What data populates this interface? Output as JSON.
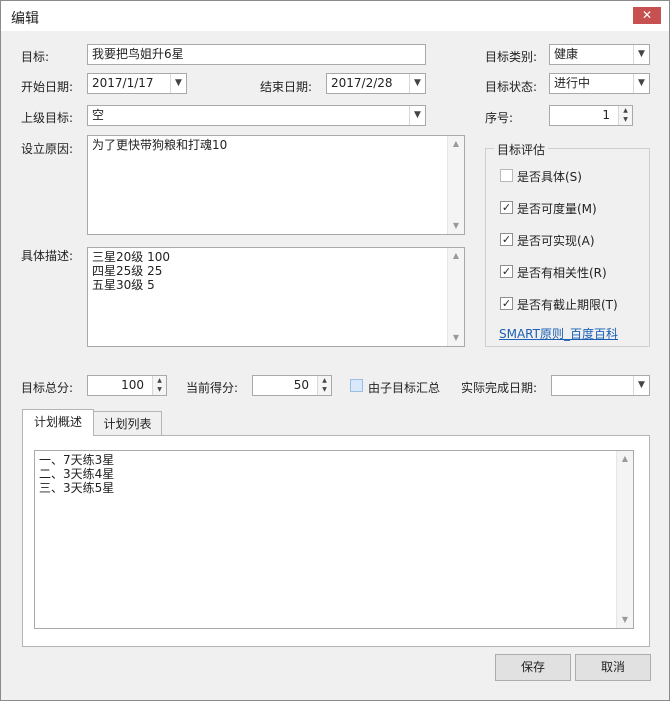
{
  "window": {
    "title": "编辑",
    "close_glyph": "✕"
  },
  "form": {
    "goal_label": "目标:",
    "goal_value": "我要把鸟姐升6星",
    "start_label": "开始日期:",
    "start_value": "2017/1/17",
    "end_label": "结束日期:",
    "end_value": "2017/2/28",
    "parent_label": "上级目标:",
    "parent_value": "空",
    "reason_label": "设立原因:",
    "reason_value": "为了更快带狗粮和打魂10",
    "desc_label": "具体描述:",
    "desc_lines": [
      "三星20级 100",
      "四星25级 25",
      "五星30级 5"
    ],
    "category_label": "目标类别:",
    "category_value": "健康",
    "status_label": "目标状态:",
    "status_value": "进行中",
    "order_label": "序号:",
    "order_value": "1"
  },
  "evaluation": {
    "title": "目标评估",
    "items": [
      {
        "label": "是否具体(S)",
        "checked": false
      },
      {
        "label": "是否可度量(M)",
        "checked": true
      },
      {
        "label": "是否可实现(A)",
        "checked": true
      },
      {
        "label": "是否有相关性(R)",
        "checked": true
      },
      {
        "label": "是否有截止期限(T)",
        "checked": true
      }
    ],
    "link": "SMART原则_百度百科"
  },
  "score": {
    "total_label": "目标总分:",
    "total_value": "100",
    "current_label": "当前得分:",
    "current_value": "50",
    "aggregate_label": "由子目标汇总",
    "finish_label": "实际完成日期:",
    "finish_value": ""
  },
  "tabs": [
    {
      "label": "计划概述",
      "active": true
    },
    {
      "label": "计划列表",
      "active": false
    }
  ],
  "plan_lines": [
    "一、7天练3星",
    "二、3天练4星",
    "三、3天练5星"
  ],
  "buttons": {
    "save": "保存",
    "cancel": "取消"
  },
  "icons": {
    "check": "✓",
    "arrow_down": "▼",
    "arrow_up": "▲"
  }
}
